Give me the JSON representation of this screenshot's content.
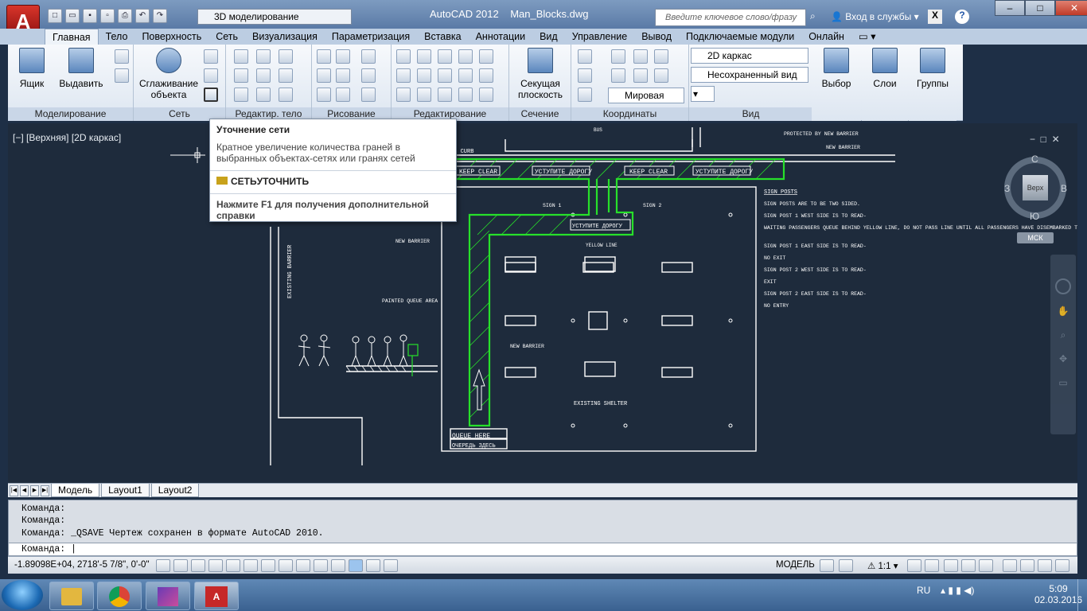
{
  "app": {
    "title": "AutoCAD 2012",
    "filename": "Man_Blocks.dwg",
    "workspace": "3D моделирование",
    "search_placeholder": "Введите ключевое слово/фразу",
    "login": "Вход в службы"
  },
  "tabs": [
    "Главная",
    "Тело",
    "Поверхность",
    "Сеть",
    "Визуализация",
    "Параметризация",
    "Вставка",
    "Аннотации",
    "Вид",
    "Управление",
    "Вывод",
    "Подключаемые модули",
    "Онлайн"
  ],
  "ribbon": {
    "box": "Ящик",
    "extrude": "Выдавить",
    "smooth1": "Сглаживание",
    "smooth2": "объекта",
    "section1": "Секущая",
    "section2": "плоскость",
    "visual_style": "2D каркас",
    "view_unsaved": "Несохраненный вид",
    "ucs": "Мировая",
    "selection": "Выбор",
    "layers": "Слои",
    "groups": "Группы",
    "panels": [
      "Моделирование",
      "Сеть",
      "Редактир. тело",
      "Рисование",
      "Редактирование",
      "Сечение",
      "Координаты",
      "Вид"
    ]
  },
  "viewport": {
    "label": "[−] [Верхняя] [2D каркас]",
    "cube_top": "Верх",
    "north": "С",
    "south": "Ю",
    "east": "В",
    "west": "З",
    "wcs": "МСК"
  },
  "tooltip": {
    "title": "Уточнение сети",
    "description": "Кратное увеличение количества граней в выбранных объектах-сетях или гранях сетей",
    "command": "СЕТЬУТОЧНИТЬ",
    "help": "Нажмите F1 для получения дополнительной справки"
  },
  "drawing": {
    "keep_clear": "KEEP CLEAR",
    "yield": "УСТУПИТЕ ДОРОГУ",
    "sign_posts": "SIGN POSTS",
    "existing_barrier": "EXISTING BARRIER",
    "new_barrier": "NEW BARRIER",
    "painted_queue": "PAINTED QUEUE AREA",
    "existing_shelter": "EXISTING SHELTER",
    "queue_here": "QUEUE HERE",
    "queue_here_ru": "ОЧЕРЕДЬ ЗДЕСЬ",
    "yellow_line": "YELLOW LINE",
    "sign1": "SIGN 1",
    "sign2": "SIGN 2",
    "protected": "PROTECTED BY NEW BARRIER",
    "bus": "BUS",
    "kerb": "NG CURB",
    "notes": [
      "SIGN POSTS ARE TO BE TWO SIDED.",
      "SIGN POST 1 WEST SIDE IS TO READ-",
      "WAITING PASSENGERS QUEUE BEHIND YELLOW LINE, DO NOT PASS LINE UNTIL ALL PASSENGERS HAVE DISEMBARKED THE BUS.",
      "SIGN POST 1 EAST SIDE IS TO READ-",
      "NO EXIT",
      "SIGN POST 2 WEST SIDE IS TO READ-",
      "EXIT",
      "SIGN POST 2 EAST SIDE IS TO READ-",
      "NO ENTRY"
    ]
  },
  "layout_tabs": [
    "Модель",
    "Layout1",
    "Layout2"
  ],
  "command_lines": [
    "Команда:",
    "Команда:",
    "Команда: _QSAVE Чертеж сохранен в формате AutoCAD 2010."
  ],
  "command_prompt": "Команда:",
  "status": {
    "coords": "-1.89098E+04, 2718'-5 7/8\", 0'-0\"",
    "model": "МОДЕЛЬ",
    "scale": "1:1"
  },
  "taskbar": {
    "lang": "RU",
    "time": "5:09",
    "date": "02.03.2016"
  }
}
